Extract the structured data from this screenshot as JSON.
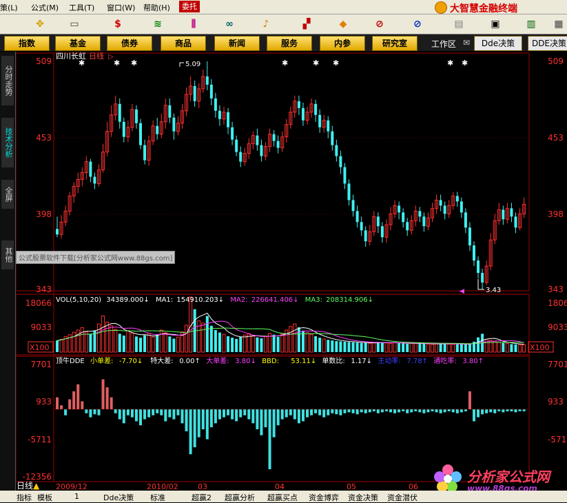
{
  "menubar": {
    "items": [
      "策(L)",
      "公式(M)",
      "工具(T)",
      "窗口(W)",
      "帮助(H)",
      "委托"
    ],
    "brand": "大智慧金融终端"
  },
  "navbar": {
    "buttons": [
      "指数",
      "基金",
      "债券",
      "商品",
      "新闻",
      "服务",
      "内参",
      "研究室"
    ],
    "workspace": "工作区",
    "dde1": "Dde决策",
    "dde2": "DDE决策"
  },
  "leftpanel": {
    "tabs": [
      "分时走势",
      "技术分析",
      "全屏",
      "其他"
    ]
  },
  "main": {
    "stock_name": "四川长虹",
    "period": "日线",
    "price_axis": [
      "509",
      "453",
      "398",
      "343"
    ],
    "high_label": "5.09",
    "low_label": "3.43",
    "watermark": "公式股票软件下载[分析家公式网www.88gs.com]"
  },
  "volume": {
    "header": "VOL(5,10,20)",
    "vol": "34389.000↓",
    "ma1_label": "MA1:",
    "ma1": "154910.203↓",
    "ma2_label": "MA2:",
    "ma2": "226641.406↓",
    "ma3_label": "MA3:",
    "ma3": "208314.906↓",
    "axis": [
      "18066",
      "9033"
    ],
    "unit": "X100"
  },
  "dde": {
    "header": "顶牛DDE",
    "indicators": [
      {
        "label": "小单差:",
        "value": "-7.70↓",
        "color": "#ffff00"
      },
      {
        "label": "特大差:",
        "value": "0.00↑",
        "color": "#ffffff"
      },
      {
        "label": "大单差:",
        "value": "3.80↓",
        "color": "#ff40ff"
      },
      {
        "label": "BBD:",
        "value": "53.11↓",
        "color": "#ffff00"
      },
      {
        "label": "单数比:",
        "value": "1.17↓",
        "color": "#ffffff"
      },
      {
        "label": "主动率:",
        "value": "7.78↑",
        "color": "#4040ff"
      },
      {
        "label": "通吃率:",
        "value": "3.80↑",
        "color": "#ff40ff"
      }
    ],
    "axis": [
      "7701",
      "933",
      "-5711",
      "-12356"
    ]
  },
  "xaxis": {
    "labels": [
      "2009/12",
      "2010/02",
      "03",
      "04",
      "05",
      "06"
    ]
  },
  "bottombar": {
    "period": "日线",
    "tabs": [
      "指标",
      "模板",
      "1",
      "Dde决策",
      "标准",
      "超赢2",
      "超赢分析",
      "超赢买点",
      "资金博弈",
      "资金决策",
      "资金潜伏"
    ]
  },
  "logo": {
    "main": "分析家公式网",
    "url": "www.88gs.com"
  },
  "chart_data": {
    "type": "candlestick",
    "candles": [
      [
        387,
        383,
        396,
        381
      ],
      [
        383,
        392,
        397,
        380
      ],
      [
        392,
        400,
        404,
        389
      ],
      [
        400,
        411,
        414,
        397
      ],
      [
        411,
        418,
        421,
        406
      ],
      [
        418,
        423,
        428,
        413
      ],
      [
        423,
        428,
        432,
        418
      ],
      [
        428,
        436,
        440,
        423
      ],
      [
        436,
        425,
        438,
        421
      ],
      [
        425,
        420,
        428,
        416
      ],
      [
        420,
        430,
        434,
        418
      ],
      [
        430,
        443,
        449,
        428
      ],
      [
        443,
        458,
        465,
        440
      ],
      [
        458,
        470,
        477,
        454
      ],
      [
        470,
        478,
        484,
        466
      ],
      [
        478,
        465,
        482,
        460
      ],
      [
        465,
        454,
        468,
        450
      ],
      [
        454,
        461,
        466,
        450
      ],
      [
        461,
        474,
        478,
        458
      ],
      [
        474,
        464,
        477,
        460
      ],
      [
        464,
        448,
        467,
        445
      ],
      [
        448,
        437,
        452,
        434
      ],
      [
        437,
        451,
        455,
        433
      ],
      [
        451,
        462,
        466,
        448
      ],
      [
        462,
        456,
        468,
        452
      ],
      [
        456,
        465,
        471,
        453
      ],
      [
        465,
        477,
        482,
        460
      ],
      [
        477,
        468,
        482,
        464
      ],
      [
        468,
        458,
        471,
        452
      ],
      [
        458,
        464,
        469,
        455
      ],
      [
        464,
        473,
        478,
        460
      ],
      [
        473,
        485,
        490,
        469
      ],
      [
        485,
        491,
        498,
        480
      ],
      [
        491,
        480,
        495,
        476
      ],
      [
        480,
        489,
        493,
        475
      ],
      [
        489,
        498,
        503,
        486
      ],
      [
        498,
        492,
        509,
        488
      ],
      [
        492,
        482,
        496,
        477
      ],
      [
        482,
        473,
        486,
        468
      ],
      [
        473,
        467,
        477,
        462
      ],
      [
        467,
        472,
        476,
        463
      ],
      [
        472,
        461,
        475,
        456
      ],
      [
        461,
        452,
        465,
        448
      ],
      [
        452,
        443,
        455,
        440
      ],
      [
        443,
        436,
        447,
        432
      ],
      [
        436,
        442,
        446,
        433
      ],
      [
        442,
        449,
        453,
        438
      ],
      [
        449,
        455,
        458,
        445
      ],
      [
        455,
        448,
        460,
        444
      ],
      [
        448,
        440,
        452,
        436
      ],
      [
        440,
        447,
        450,
        437
      ],
      [
        447,
        456,
        460,
        443
      ],
      [
        456,
        451,
        459,
        447
      ],
      [
        451,
        446,
        455,
        442
      ],
      [
        446,
        454,
        458,
        443
      ],
      [
        454,
        463,
        467,
        450
      ],
      [
        463,
        472,
        476,
        460
      ],
      [
        472,
        480,
        484,
        468
      ],
      [
        480,
        475,
        484,
        470
      ],
      [
        475,
        466,
        479,
        462
      ],
      [
        466,
        472,
        476,
        463
      ],
      [
        472,
        478,
        482,
        468
      ],
      [
        478,
        470,
        481,
        465
      ],
      [
        470,
        461,
        474,
        457
      ],
      [
        461,
        466,
        470,
        457
      ],
      [
        466,
        458,
        469,
        453
      ],
      [
        458,
        448,
        462,
        444
      ],
      [
        448,
        440,
        452,
        436
      ],
      [
        440,
        432,
        444,
        427
      ],
      [
        432,
        420,
        435,
        416
      ],
      [
        420,
        408,
        423,
        404
      ],
      [
        408,
        400,
        412,
        396
      ],
      [
        400,
        392,
        404,
        388
      ],
      [
        392,
        386,
        396,
        382
      ],
      [
        386,
        378,
        389,
        374
      ],
      [
        378,
        385,
        390,
        375
      ],
      [
        385,
        396,
        400,
        382
      ],
      [
        396,
        389,
        399,
        384
      ],
      [
        389,
        381,
        392,
        377
      ],
      [
        381,
        390,
        394,
        377
      ],
      [
        390,
        398,
        403,
        386
      ],
      [
        398,
        404,
        408,
        395
      ],
      [
        404,
        399,
        407,
        394
      ],
      [
        399,
        392,
        402,
        388
      ],
      [
        392,
        386,
        395,
        382
      ],
      [
        386,
        393,
        397,
        383
      ],
      [
        393,
        400,
        404,
        389
      ],
      [
        400,
        396,
        403,
        392
      ],
      [
        396,
        389,
        399,
        385
      ],
      [
        389,
        395,
        399,
        386
      ],
      [
        395,
        402,
        406,
        392
      ],
      [
        402,
        408,
        412,
        398
      ],
      [
        408,
        404,
        412,
        400
      ],
      [
        404,
        398,
        407,
        394
      ],
      [
        398,
        404,
        408,
        395
      ],
      [
        404,
        411,
        414,
        401
      ],
      [
        411,
        407,
        414,
        403
      ],
      [
        407,
        399,
        410,
        395
      ],
      [
        399,
        388,
        402,
        384
      ],
      [
        388,
        375,
        392,
        371
      ],
      [
        375,
        364,
        378,
        360
      ],
      [
        364,
        355,
        367,
        351
      ],
      [
        355,
        348,
        358,
        343
      ],
      [
        348,
        360,
        364,
        346
      ],
      [
        360,
        379,
        384,
        357
      ],
      [
        379,
        393,
        398,
        376
      ],
      [
        393,
        401,
        406,
        390
      ],
      [
        401,
        394,
        404,
        390
      ],
      [
        394,
        402,
        406,
        391
      ],
      [
        402,
        396,
        406,
        392
      ],
      [
        396,
        388,
        399,
        384
      ],
      [
        388,
        398,
        402,
        386
      ],
      [
        398,
        405,
        410,
        395
      ]
    ],
    "volume": [
      38,
      42,
      51,
      57,
      65,
      72,
      80,
      66,
      58,
      71,
      92,
      118,
      98,
      86,
      74,
      60,
      54,
      70,
      62,
      51,
      47,
      55,
      61,
      49,
      58,
      72,
      63,
      51,
      44,
      49,
      66,
      88,
      180,
      140,
      102,
      95,
      118,
      86,
      72,
      64,
      58,
      52,
      47,
      43,
      50,
      56,
      61,
      53,
      48,
      45,
      52,
      61,
      57,
      50,
      60,
      72,
      84,
      92,
      81,
      70,
      64,
      58,
      52,
      47,
      43,
      40,
      38,
      36,
      35,
      34,
      33,
      32,
      31,
      30,
      30,
      29,
      31,
      33,
      32,
      30,
      29,
      31,
      30,
      28,
      27,
      29,
      30,
      28,
      27,
      26,
      25,
      27,
      29,
      28,
      26,
      25,
      27,
      26,
      25,
      27,
      34,
      48,
      60,
      42,
      38,
      35,
      32,
      30,
      28,
      26,
      25,
      24,
      24
    ],
    "dde_values": [
      12,
      4,
      -6,
      10,
      18,
      25,
      8,
      -4,
      -8,
      -5,
      -6,
      30,
      22,
      12,
      -4,
      -10,
      -14,
      -6,
      -8,
      -12,
      -16,
      -10,
      -8,
      -6,
      -4,
      -6,
      -12,
      -8,
      -10,
      -6,
      -14,
      -22,
      -45,
      -38,
      -28,
      -20,
      -30,
      -18,
      -14,
      -10,
      -8,
      -6,
      -10,
      -12,
      -8,
      -6,
      -10,
      -14,
      -20,
      -26,
      -18,
      -60,
      -28,
      -16,
      -10,
      -8,
      -6,
      -10,
      -14,
      -12,
      -8,
      -6,
      -4,
      -6,
      -8,
      -6,
      -4,
      -5,
      -6,
      -4,
      -3,
      -4,
      -5,
      -3,
      -4,
      -3,
      -2,
      -4,
      -3,
      -2,
      -3,
      -4,
      -3,
      -2,
      -4,
      -3,
      -2,
      -3,
      -4,
      -3,
      -2,
      -3,
      -4,
      -3,
      -2,
      -3,
      -4,
      -3,
      -2,
      18,
      -12,
      -8,
      -5,
      -4,
      -3,
      -4,
      -2,
      -3,
      -2,
      -2,
      -3,
      -2,
      -2
    ],
    "ylim": [
      343,
      509
    ],
    "markers_x": [
      117,
      168,
      193,
      412,
      457,
      486,
      652,
      673
    ]
  }
}
